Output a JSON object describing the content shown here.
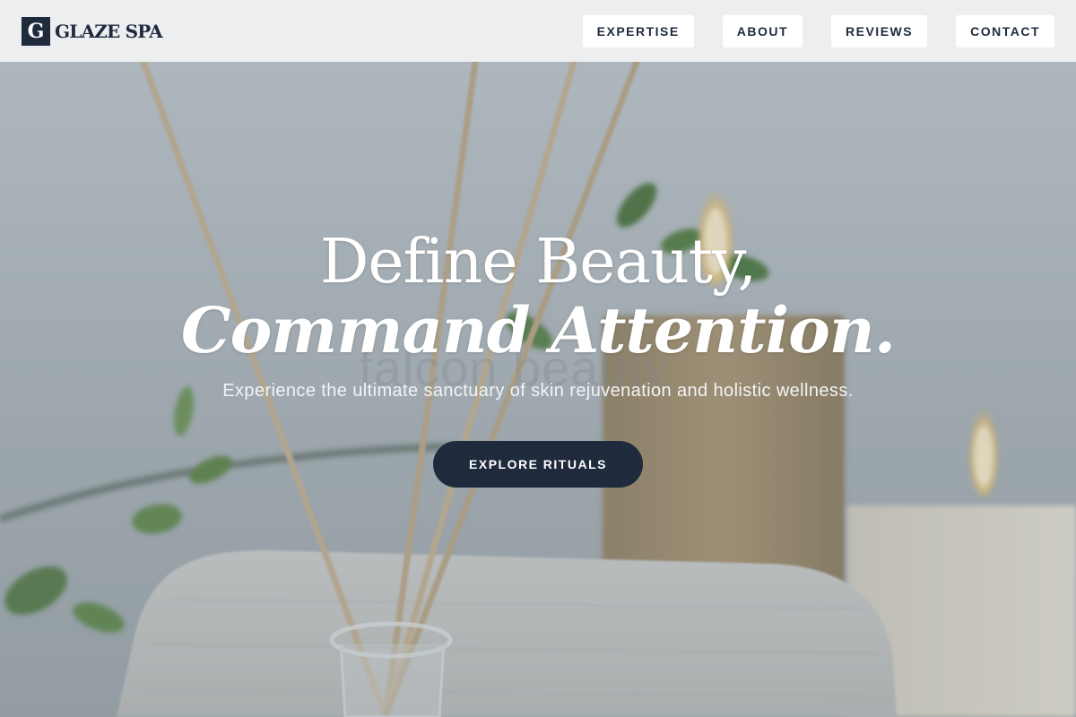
{
  "brand": {
    "mark": "G",
    "name": "GLAZE SPA"
  },
  "nav": {
    "items": [
      {
        "label": "EXPERTISE"
      },
      {
        "label": "ABOUT"
      },
      {
        "label": "REVIEWS"
      },
      {
        "label": "CONTACT"
      }
    ]
  },
  "hero": {
    "title_line1": "Define Beauty,",
    "title_line2": "Command Attention.",
    "watermark": "falcon beauty",
    "subtitle": "Experience the ultimate sanctuary of skin rejuvenation and holistic wellness.",
    "cta_label": "EXPLORE RITUALS"
  },
  "colors": {
    "brand_navy": "#1f2a3d",
    "header_bg": "#eceeef",
    "hero_text": "#ffffff"
  }
}
